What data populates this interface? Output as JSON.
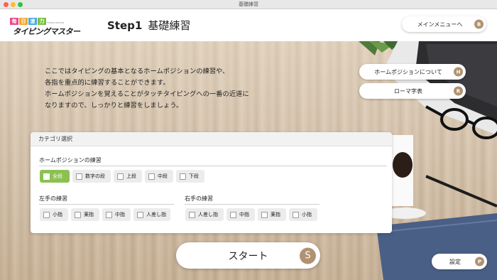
{
  "window": {
    "title": "基礎練習"
  },
  "logo": {
    "boxes": [
      "毎",
      "日",
      "速",
      "力"
    ],
    "main": "タイピングマスター",
    "sub": "TYPING MASTER"
  },
  "header": {
    "step": "Step1",
    "title": "基礎練習"
  },
  "nav": {
    "main_menu": {
      "label": "メインメニューへ",
      "key": "B"
    },
    "home_position": {
      "label": "ホームポジションについて",
      "key": "H"
    },
    "romaji_table": {
      "label": "ローマ字表",
      "key": "R"
    },
    "settings": {
      "label": "設定",
      "key": "P"
    }
  },
  "intro": [
    "ここではタイピングの基本となるホームポジションの練習や、",
    "各指を重点的に練習することができます。",
    "ホームポジションを覚えることがタッチタイピングへの一番の近道に",
    "なりますので、しっかりと練習をしましょう。"
  ],
  "category": {
    "title": "カテゴリ選択",
    "home": {
      "title": "ホームポジションの練習",
      "options": [
        {
          "label": "全段",
          "checked": true
        },
        {
          "label": "数字の段",
          "checked": false
        },
        {
          "label": "上段",
          "checked": false
        },
        {
          "label": "中段",
          "checked": false
        },
        {
          "label": "下段",
          "checked": false
        }
      ]
    },
    "left": {
      "title": "左手の練習",
      "options": [
        {
          "label": "小指",
          "checked": false
        },
        {
          "label": "薬指",
          "checked": false
        },
        {
          "label": "中指",
          "checked": false
        },
        {
          "label": "人差し指",
          "checked": false
        }
      ]
    },
    "right": {
      "title": "右手の練習",
      "options": [
        {
          "label": "人差し指",
          "checked": false
        },
        {
          "label": "中指",
          "checked": false
        },
        {
          "label": "薬指",
          "checked": false
        },
        {
          "label": "小指",
          "checked": false
        }
      ]
    }
  },
  "start": {
    "label": "スタート",
    "key": "S"
  },
  "colors": {
    "accent": "#b09272",
    "selected": "#8cc152"
  }
}
